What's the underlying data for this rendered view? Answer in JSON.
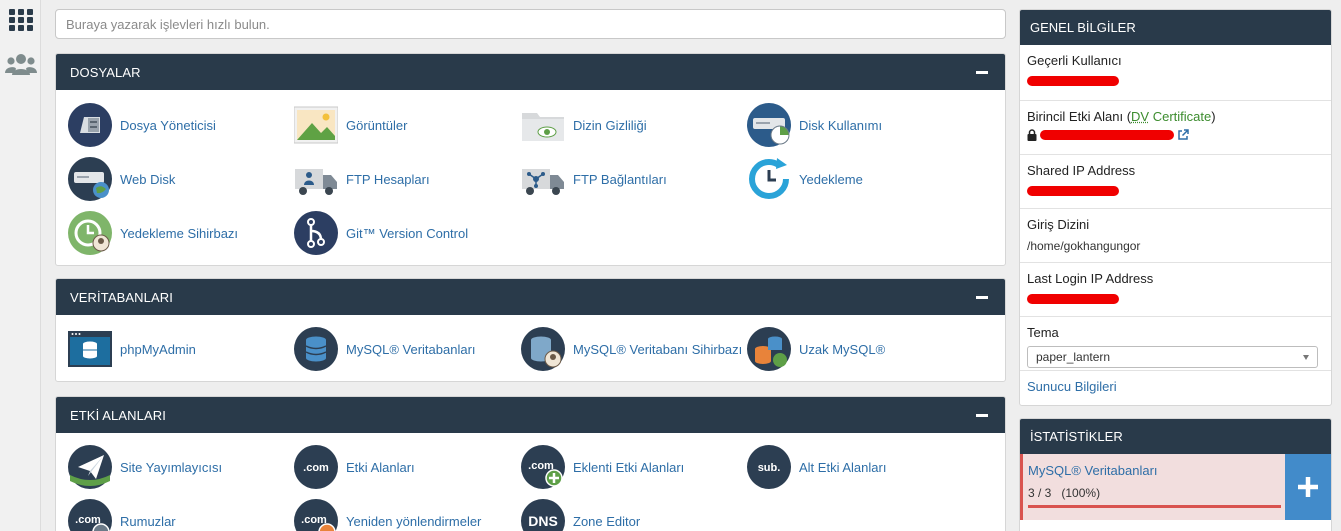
{
  "search": {
    "placeholder": "Buraya yazarak işlevleri hızlı bulun."
  },
  "rail": {
    "apps_icon": "grid-icon",
    "users_icon": "users-icon"
  },
  "sections": {
    "files": {
      "title": "DOSYALAR",
      "items": [
        "Dosya Yöneticisi",
        "Görüntüler",
        "Dizin Gizliliği",
        "Disk Kullanımı",
        "Web Disk",
        "FTP Hesapları",
        "FTP Bağlantıları",
        "Yedekleme",
        "Yedekleme Sihirbazı",
        "Git™ Version Control"
      ]
    },
    "databases": {
      "title": "VERİTABANLARI",
      "items": [
        "phpMyAdmin",
        "MySQL® Veritabanları",
        "MySQL® Veritabanı Sihirbazı",
        "Uzak MySQL®"
      ]
    },
    "domains": {
      "title": "ETKİ ALANLARI",
      "items": [
        "Site Yayımlayıcısı",
        "Etki Alanları",
        "Eklenti Etki Alanları",
        "Alt Etki Alanları",
        "Rumuzlar",
        "Yeniden yönlendirmeler",
        "Zone Editor"
      ]
    }
  },
  "general": {
    "title": "GENEL BİLGİLER",
    "current_user_label": "Geçerli Kullanıcı",
    "primary_domain_label_a": "Birincil Etki Alanı (",
    "primary_domain_dv": "DV",
    "primary_domain_label_b": " Certificate",
    "primary_domain_label_c": ")",
    "shared_ip_label": "Shared IP Address",
    "home_dir_label": "Giriş Dizini",
    "home_dir_value": "/home/gokhangungor",
    "last_login_label": "Last Login IP Address",
    "theme_label": "Tema",
    "theme_value": "paper_lantern",
    "server_info_link": "Sunucu Bilgileri"
  },
  "stats": {
    "title": "İSTATİSTİKLER",
    "items": [
      {
        "name": "MySQL® Veritabanları",
        "count": "3 / 3",
        "percent_text": "(100%)",
        "usage_fraction": 1.0
      }
    ]
  },
  "colors": {
    "header_bg": "#293a4a",
    "link": "#2e6ea7",
    "redaction": "#f00000",
    "stat_alert_bg": "#f2dede",
    "stat_alert_bar": "#d9534f",
    "plus_button": "#428bca"
  }
}
